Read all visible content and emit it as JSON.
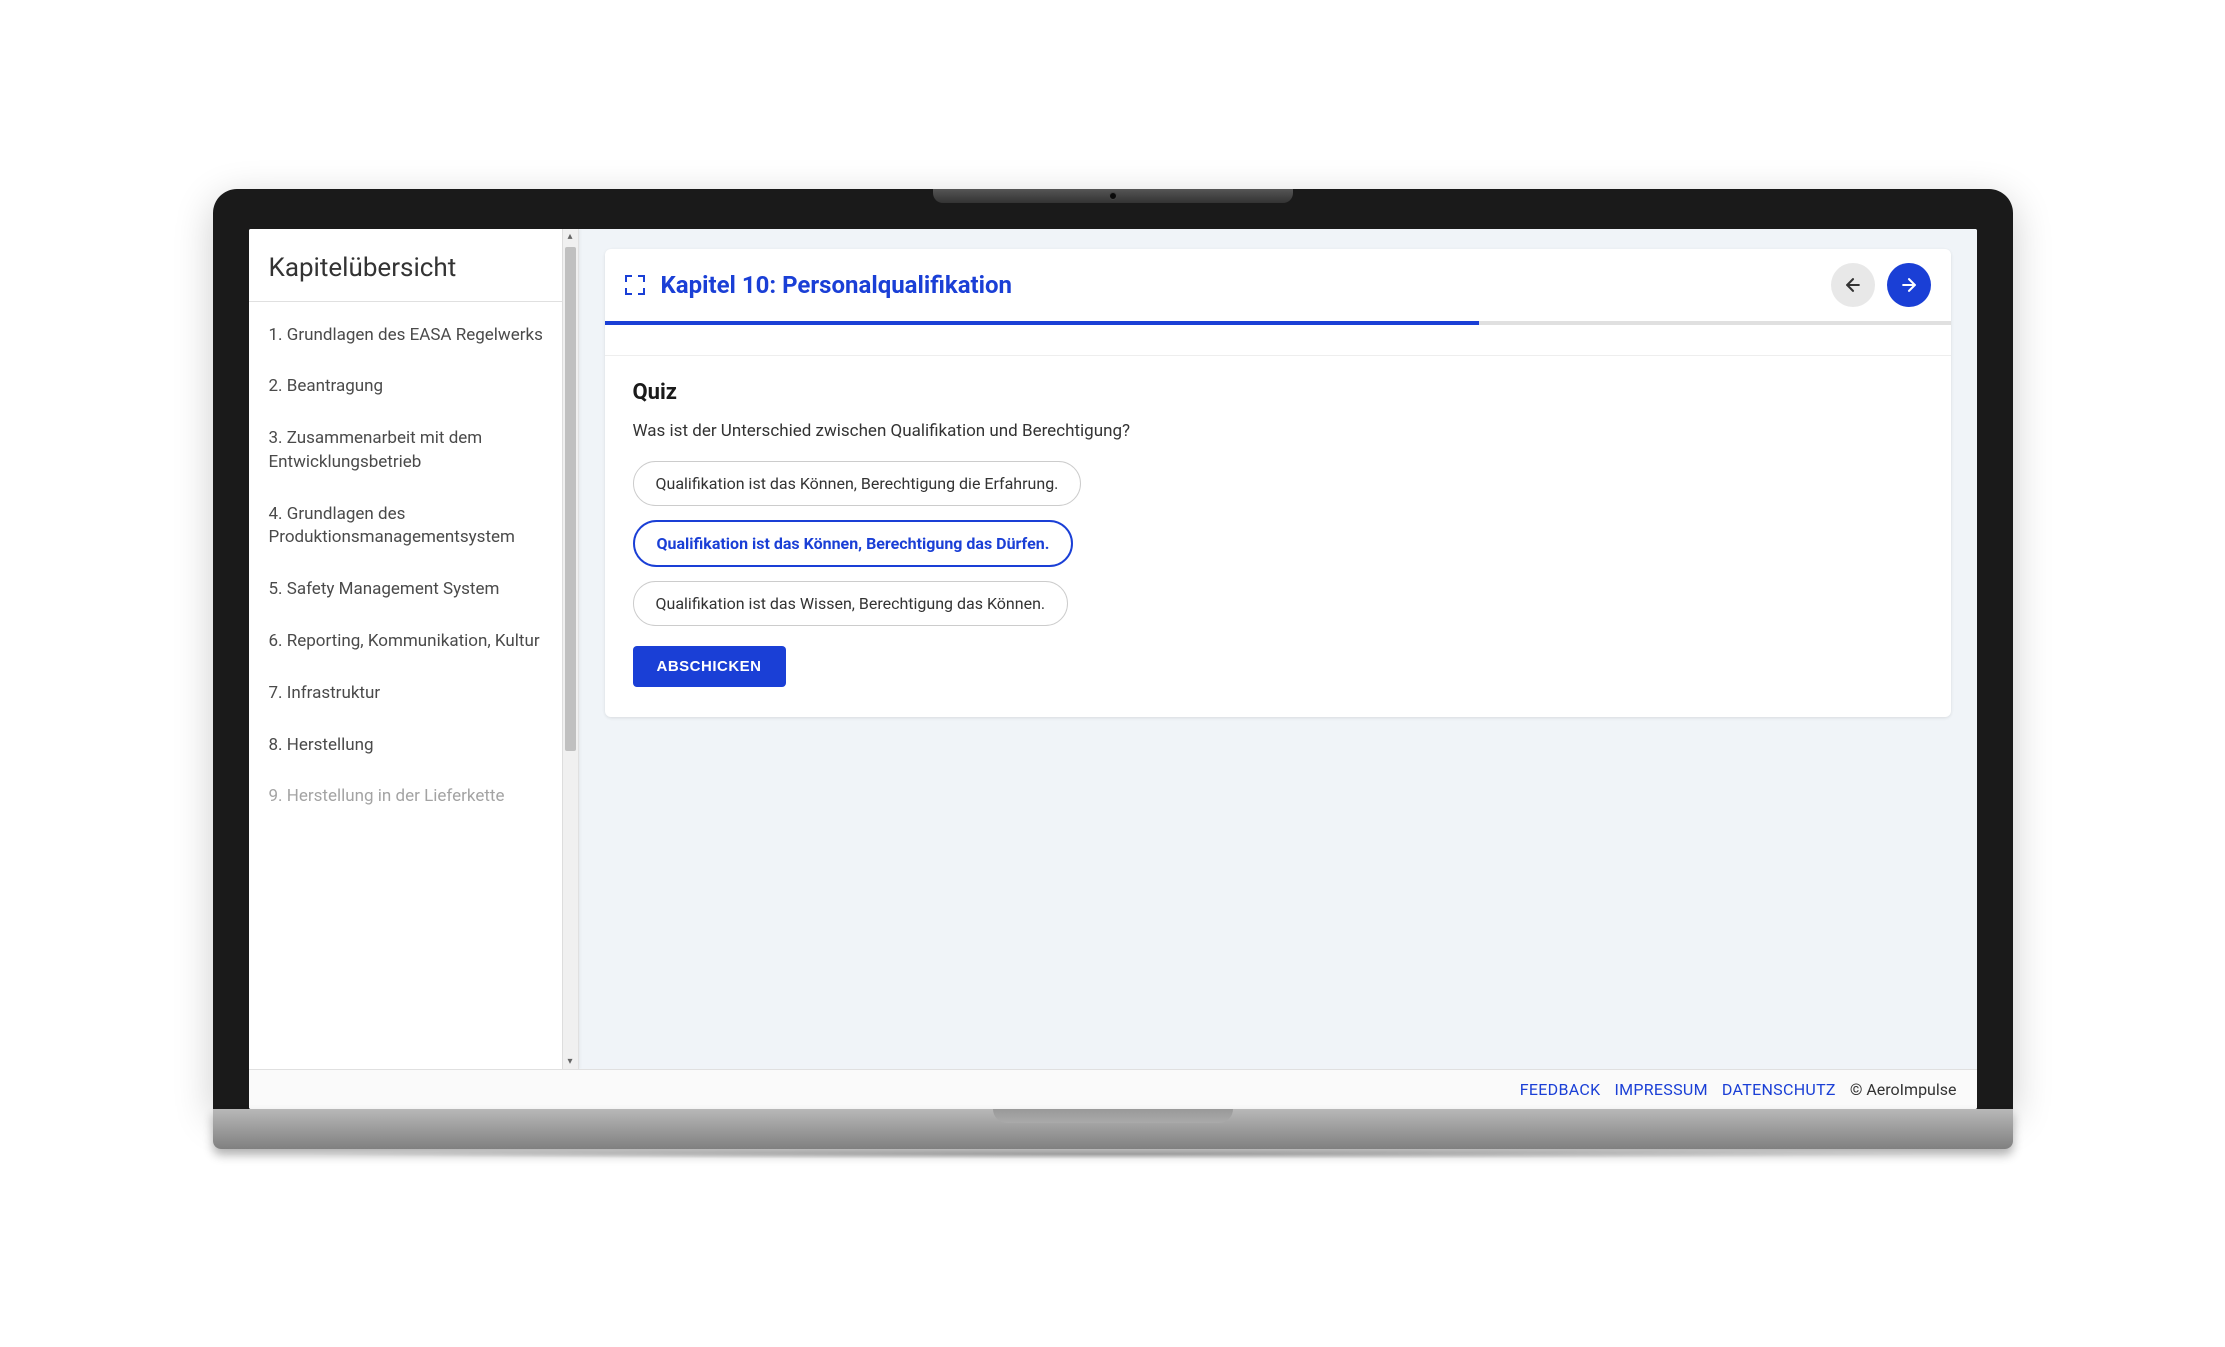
{
  "sidebar": {
    "title": "Kapitelübersicht",
    "items": [
      "1. Grundlagen des EASA Regelwerks",
      "2. Beantragung",
      "3. Zusammenarbeit mit dem Entwicklungsbetrieb",
      "4. Grundlagen des Produktionsmanagementsystem",
      "5. Safety Management System",
      "6. Reporting, Kommunikation, Kultur",
      "7. Infrastruktur",
      "8. Herstellung",
      "9. Herstellung in der Lieferkette"
    ]
  },
  "header": {
    "chapter_title": "Kapitel 10: Personalqualifikation"
  },
  "quiz": {
    "title": "Quiz",
    "question": "Was ist der Unterschied zwischen Qualifikation und Berechtigung?",
    "options": [
      "Qualifikation ist das Können, Berechtigung die Erfahrung.",
      "Qualifikation ist das Können, Berechtigung das Dürfen.",
      "Qualifikation ist das Wissen, Berechtigung das Können."
    ],
    "selected_index": 1,
    "submit_label": "ABSCHICKEN"
  },
  "footer": {
    "links": [
      "FEEDBACK",
      "IMPRESSUM",
      "DATENSCHUTZ"
    ],
    "copyright": "© AeroImpulse"
  },
  "progress_percent": 65
}
